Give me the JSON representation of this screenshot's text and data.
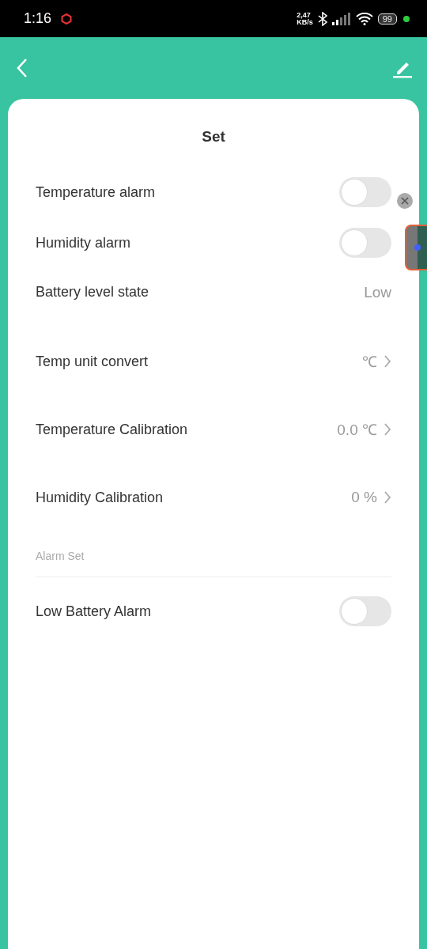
{
  "status_bar": {
    "time": "1:16",
    "speed_value": "2,47",
    "speed_unit": "KB/s",
    "battery": "99"
  },
  "card": {
    "title": "Set",
    "rows": [
      {
        "kind": "toggle",
        "label": "Temperature alarm",
        "on": false
      },
      {
        "kind": "toggle",
        "label": "Humidity alarm",
        "on": false
      },
      {
        "kind": "value",
        "label": "Battery level state",
        "value": "Low"
      },
      {
        "kind": "link",
        "label": "Temp unit convert",
        "value": "℃"
      },
      {
        "kind": "link",
        "label": "Temperature Calibration",
        "value": "0.0 ℃"
      },
      {
        "kind": "link",
        "label": "Humidity Calibration",
        "value": "0 %"
      }
    ],
    "section": {
      "title": "Alarm Set",
      "rows": [
        {
          "kind": "toggle",
          "label": "Low Battery Alarm",
          "on": false
        }
      ]
    }
  }
}
